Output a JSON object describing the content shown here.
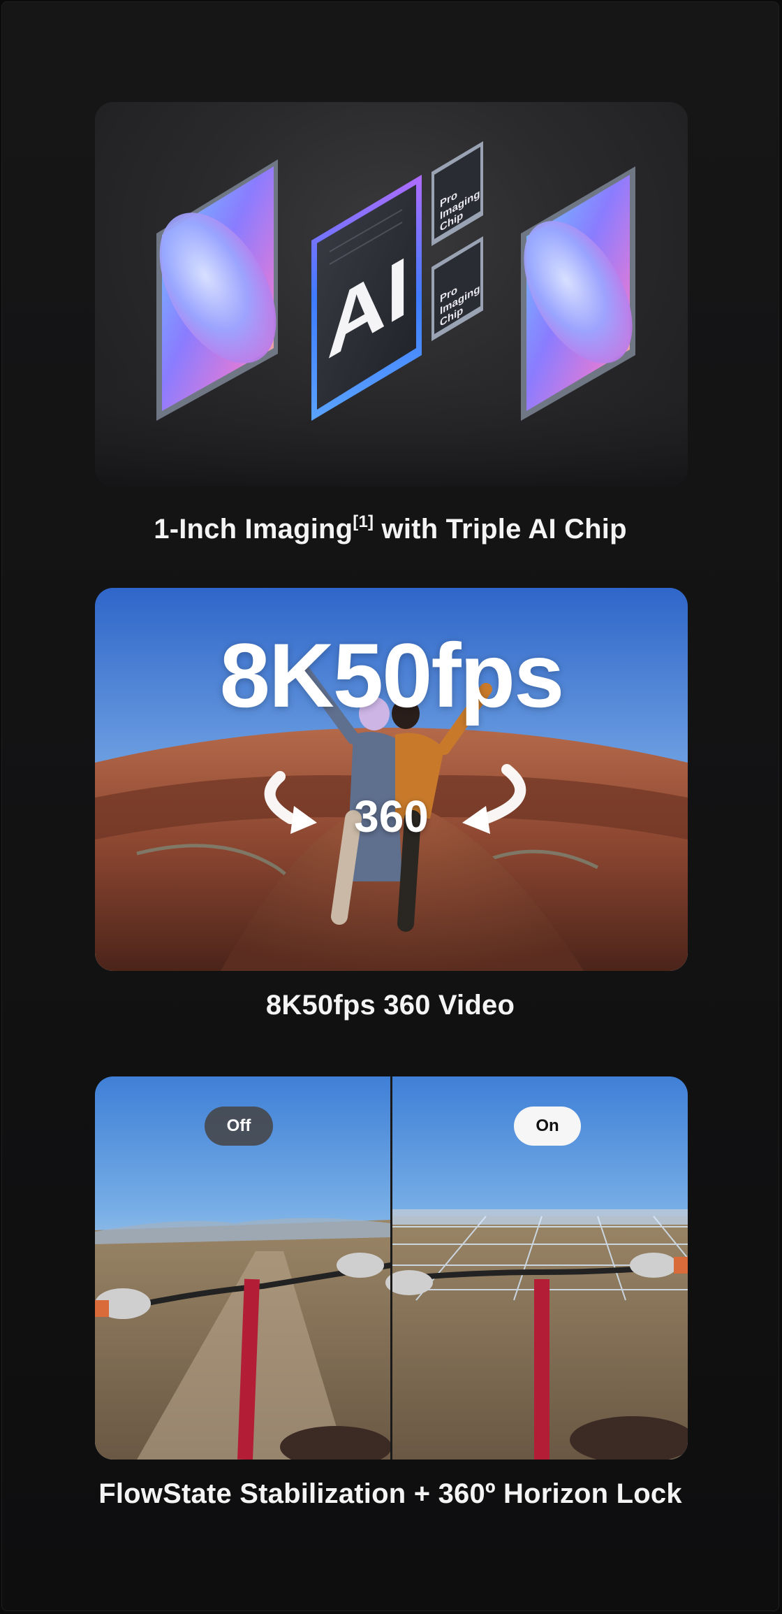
{
  "sections": [
    {
      "caption_main": "1-Inch Imaging",
      "caption_sup": "[1]",
      "caption_rest": " with Triple AI Chip",
      "chip_center_text": "AI",
      "side_chip_lines": [
        "Pro",
        "Imaging",
        "Chip"
      ]
    },
    {
      "caption": "8K50fps 360 Video",
      "overlay_title": "8K50fps",
      "overlay_sub": "360"
    },
    {
      "caption": "FlowState Stabilization + 360º Horizon Lock",
      "toggle_off_label": "Off",
      "toggle_on_label": "On"
    }
  ],
  "colors": {
    "background": "#121213",
    "caption_text": "#f4f4f5",
    "accent_purple": "#b06cff",
    "accent_blue": "#3e7bff"
  }
}
